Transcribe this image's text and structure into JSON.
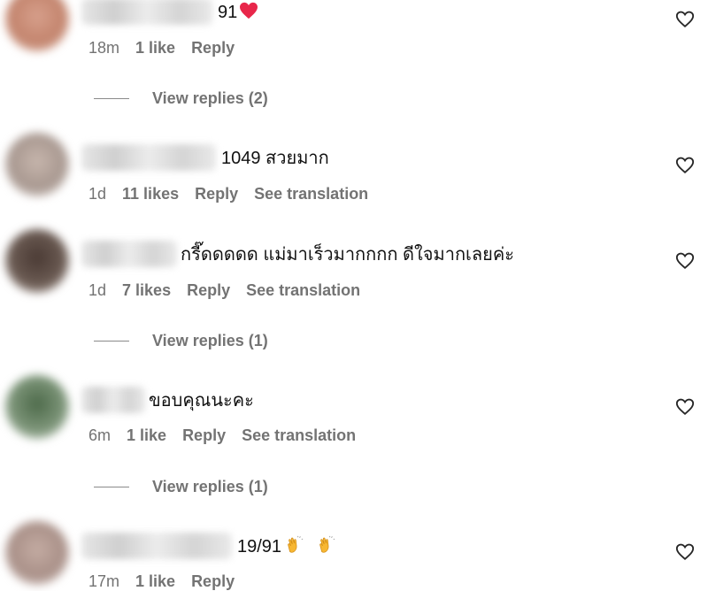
{
  "comments": [
    {
      "text": "91",
      "emoji": "red-heart-emoji",
      "time": "18m",
      "likes": "1 like",
      "reply": "Reply",
      "translate": "",
      "view_replies": "View replies (2)",
      "avatar_color": "#c98f7a"
    },
    {
      "text": "1049 สวยมาก",
      "time": "1d",
      "likes": "11 likes",
      "reply": "Reply",
      "translate": "See translation",
      "view_replies": "",
      "avatar_color": "#b7a9a2"
    },
    {
      "text": "กรี๊ดดดดด แม่มาเร็วมากกกก ดีใจมากเลยค่ะ",
      "time": "1d",
      "likes": "7 likes",
      "reply": "Reply",
      "translate": "See translation",
      "view_replies": "View replies (1)",
      "avatar_color": "#5a4a43"
    },
    {
      "text": "ขอบคุณนะคะ",
      "time": "6m",
      "likes": "1 like",
      "reply": "Reply",
      "translate": "See translation",
      "view_replies": "View replies (1)",
      "avatar_color": "#5f7a5a"
    },
    {
      "text": "19/91",
      "emoji": "clapping-hands-emoji",
      "time": "17m",
      "likes": "1 like",
      "reply": "Reply",
      "translate": "",
      "view_replies": "",
      "avatar_color": "#bba39a"
    }
  ],
  "icons": {
    "like": "heart-outline-icon"
  }
}
